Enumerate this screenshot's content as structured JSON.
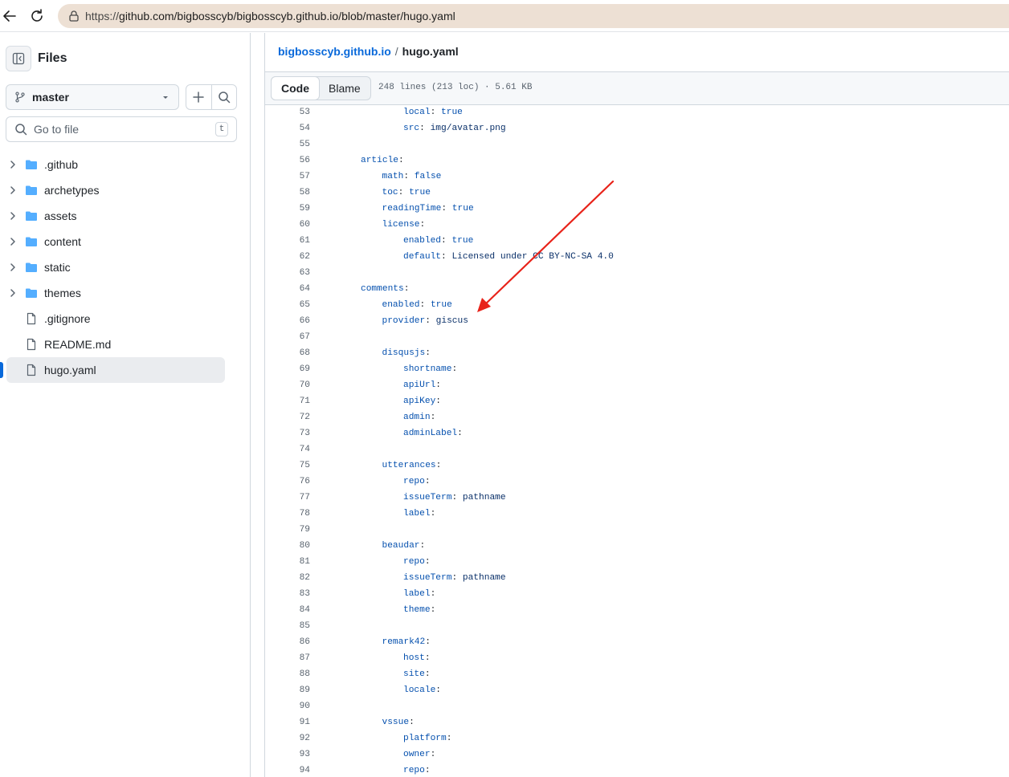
{
  "browser": {
    "url_prefix": "https://",
    "url_host_path": "github.com/bigbosscyb/bigbosscyb.github.io/blob/master/hugo.yaml"
  },
  "sidebar": {
    "title": "Files",
    "branch": "master",
    "goto_placeholder": "Go to file",
    "goto_shortcut": "t",
    "items": [
      {
        "label": ".github",
        "type": "folder"
      },
      {
        "label": "archetypes",
        "type": "folder"
      },
      {
        "label": "assets",
        "type": "folder"
      },
      {
        "label": "content",
        "type": "folder"
      },
      {
        "label": "static",
        "type": "folder"
      },
      {
        "label": "themes",
        "type": "folder"
      },
      {
        "label": ".gitignore",
        "type": "file"
      },
      {
        "label": "README.md",
        "type": "file"
      },
      {
        "label": "hugo.yaml",
        "type": "file",
        "selected": true
      }
    ]
  },
  "main": {
    "breadcrumb": {
      "repo": "bigbosscyb.github.io",
      "separator": "/",
      "file": "hugo.yaml"
    },
    "tabs": [
      {
        "label": "Code",
        "active": true
      },
      {
        "label": "Blame",
        "active": false
      }
    ],
    "file_info": "248 lines (213 loc) · 5.61 KB",
    "lines": [
      {
        "n": "53",
        "indent": 3,
        "key": "local",
        "value": "true"
      },
      {
        "n": "54",
        "indent": 3,
        "key": "src",
        "value": "img/avatar.png"
      },
      {
        "n": "55",
        "indent": 0,
        "key": "",
        "value": ""
      },
      {
        "n": "56",
        "indent": 1,
        "key": "article",
        "value": ""
      },
      {
        "n": "57",
        "indent": 2,
        "key": "math",
        "value": "false"
      },
      {
        "n": "58",
        "indent": 2,
        "key": "toc",
        "value": "true"
      },
      {
        "n": "59",
        "indent": 2,
        "key": "readingTime",
        "value": "true"
      },
      {
        "n": "60",
        "indent": 2,
        "key": "license",
        "value": ""
      },
      {
        "n": "61",
        "indent": 3,
        "key": "enabled",
        "value": "true"
      },
      {
        "n": "62",
        "indent": 3,
        "key": "default",
        "value": "Licensed under CC BY-NC-SA 4.0"
      },
      {
        "n": "63",
        "indent": 0,
        "key": "",
        "value": ""
      },
      {
        "n": "64",
        "indent": 1,
        "key": "comments",
        "value": ""
      },
      {
        "n": "65",
        "indent": 2,
        "key": "enabled",
        "value": "true"
      },
      {
        "n": "66",
        "indent": 2,
        "key": "provider",
        "value": "giscus"
      },
      {
        "n": "67",
        "indent": 0,
        "key": "",
        "value": ""
      },
      {
        "n": "68",
        "indent": 2,
        "key": "disqusjs",
        "value": ""
      },
      {
        "n": "69",
        "indent": 3,
        "key": "shortname",
        "value": ""
      },
      {
        "n": "70",
        "indent": 3,
        "key": "apiUrl",
        "value": ""
      },
      {
        "n": "71",
        "indent": 3,
        "key": "apiKey",
        "value": ""
      },
      {
        "n": "72",
        "indent": 3,
        "key": "admin",
        "value": ""
      },
      {
        "n": "73",
        "indent": 3,
        "key": "adminLabel",
        "value": ""
      },
      {
        "n": "74",
        "indent": 0,
        "key": "",
        "value": ""
      },
      {
        "n": "75",
        "indent": 2,
        "key": "utterances",
        "value": ""
      },
      {
        "n": "76",
        "indent": 3,
        "key": "repo",
        "value": ""
      },
      {
        "n": "77",
        "indent": 3,
        "key": "issueTerm",
        "value": "pathname"
      },
      {
        "n": "78",
        "indent": 3,
        "key": "label",
        "value": ""
      },
      {
        "n": "79",
        "indent": 0,
        "key": "",
        "value": ""
      },
      {
        "n": "80",
        "indent": 2,
        "key": "beaudar",
        "value": ""
      },
      {
        "n": "81",
        "indent": 3,
        "key": "repo",
        "value": ""
      },
      {
        "n": "82",
        "indent": 3,
        "key": "issueTerm",
        "value": "pathname"
      },
      {
        "n": "83",
        "indent": 3,
        "key": "label",
        "value": ""
      },
      {
        "n": "84",
        "indent": 3,
        "key": "theme",
        "value": ""
      },
      {
        "n": "85",
        "indent": 0,
        "key": "",
        "value": ""
      },
      {
        "n": "86",
        "indent": 2,
        "key": "remark42",
        "value": ""
      },
      {
        "n": "87",
        "indent": 3,
        "key": "host",
        "value": ""
      },
      {
        "n": "88",
        "indent": 3,
        "key": "site",
        "value": ""
      },
      {
        "n": "89",
        "indent": 3,
        "key": "locale",
        "value": ""
      },
      {
        "n": "90",
        "indent": 0,
        "key": "",
        "value": ""
      },
      {
        "n": "91",
        "indent": 2,
        "key": "vssue",
        "value": ""
      },
      {
        "n": "92",
        "indent": 3,
        "key": "platform",
        "value": ""
      },
      {
        "n": "93",
        "indent": 3,
        "key": "owner",
        "value": ""
      },
      {
        "n": "94",
        "indent": 3,
        "key": "repo",
        "value": ""
      }
    ]
  },
  "colors": {
    "accent": "#0969da",
    "yaml_key": "#0550ae",
    "yaml_value": "#0a3069",
    "annotation_arrow": "#e8231a"
  }
}
